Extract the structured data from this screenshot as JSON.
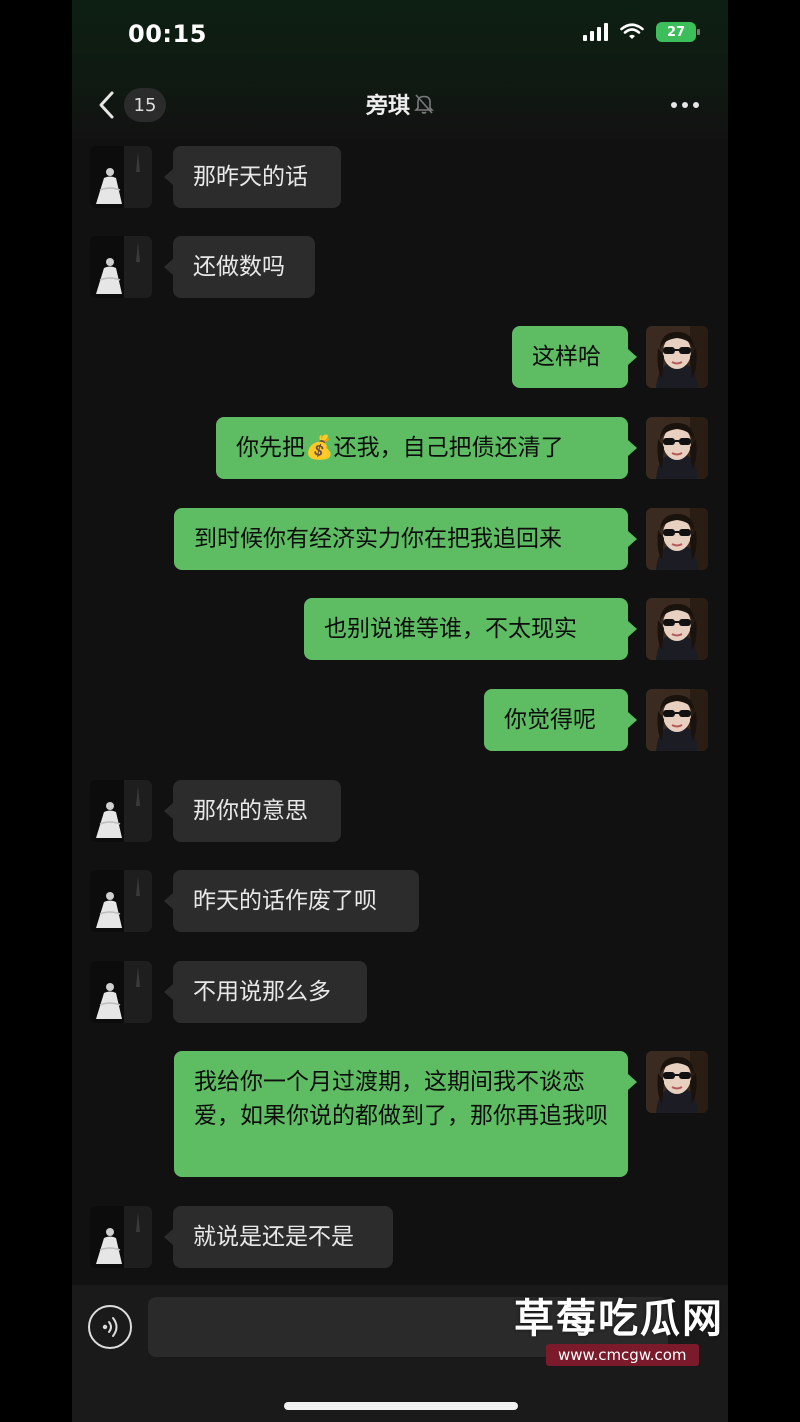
{
  "status_bar": {
    "time": "00:15",
    "battery": "27"
  },
  "nav": {
    "unread_count": "15",
    "title": "旁琪"
  },
  "messages": [
    {
      "side": "in",
      "text": "那昨天的话"
    },
    {
      "side": "in",
      "text": "还做数吗"
    },
    {
      "side": "out",
      "text": "这样哈"
    },
    {
      "side": "out",
      "text": "你先把💰还我，自己把债还清了"
    },
    {
      "side": "out",
      "text": "到时候你有经济实力你在把我追回来"
    },
    {
      "side": "out",
      "text": "也别说谁等谁，不太现实"
    },
    {
      "side": "out",
      "text": "你觉得呢"
    },
    {
      "side": "in",
      "text": "那你的意思"
    },
    {
      "side": "in",
      "text": "昨天的话作废了呗"
    },
    {
      "side": "in",
      "text": "不用说那么多"
    },
    {
      "side": "out",
      "text": "我给你一个月过渡期，这期间我不谈恋爱，如果你说的都做到了，那你再追我呗"
    },
    {
      "side": "in",
      "text": "就说是还是不是"
    }
  ],
  "watermark": {
    "title": "草莓吃瓜网",
    "url": "www.cmcgw.com"
  },
  "colors": {
    "bubble_out": "#5ebd63",
    "bubble_in": "#2c2c2c",
    "background": "#111111"
  },
  "icons": {
    "back": "chevron-left-icon",
    "mute": "bell-off-icon",
    "more": "more-dots-icon",
    "voice": "voice-input-icon"
  }
}
